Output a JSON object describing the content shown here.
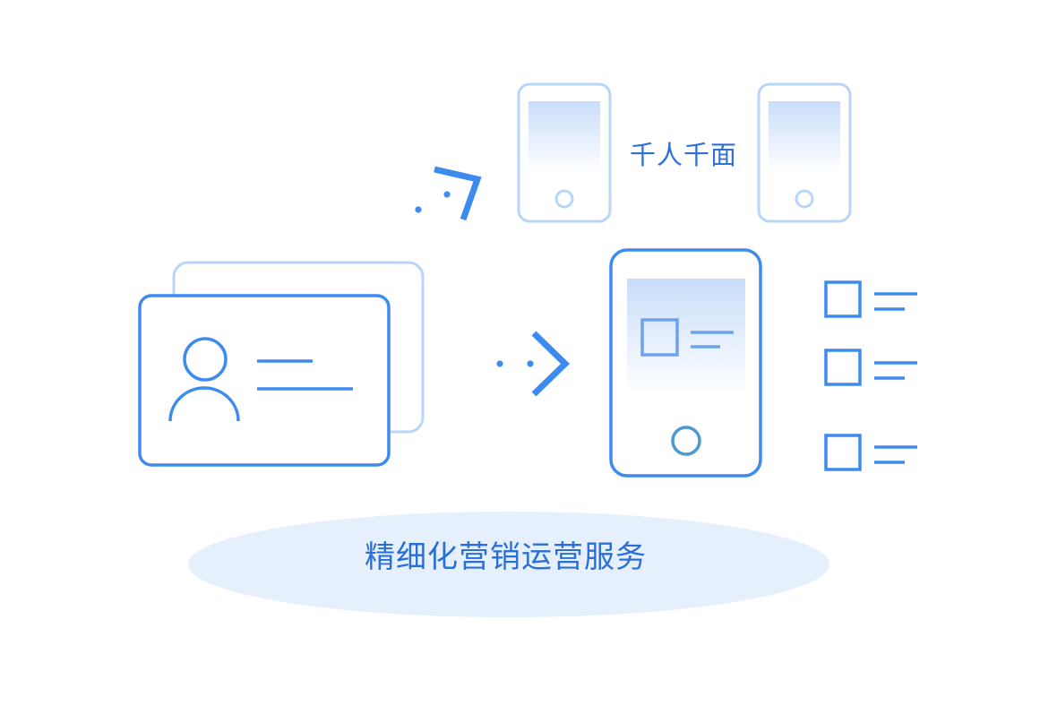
{
  "labels": {
    "top": "千人千面",
    "bottom": "精细化营销运营服务"
  },
  "colors": {
    "primary": "#3d8bf0",
    "light": "#b8d5fa",
    "platform": "#e6f0fc",
    "screen_top": "#c9ddfa",
    "home_ring": "#4a9ad0"
  },
  "icons": [
    "id-card-icon",
    "arrow-right-icon",
    "phone-icon",
    "checklist-icon"
  ]
}
